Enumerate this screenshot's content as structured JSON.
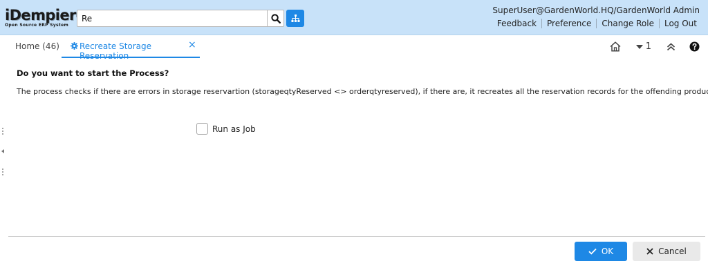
{
  "header": {
    "logo_text": "iDempiere",
    "logo_subtext": "Open Source ERP System",
    "search": {
      "value": "Re",
      "placeholder": ""
    },
    "search_icon": "search-icon",
    "menu_icon": "sitemap-icon",
    "user": "SuperUser@GardenWorld.HQ/GardenWorld Admin",
    "links": [
      "Feedback",
      "Preference",
      "Change Role",
      "Log Out"
    ]
  },
  "tabs": {
    "home": "Home (46)",
    "active": {
      "label": "Recreate Storage Reservation",
      "icon": "gear-icon",
      "close": "×"
    }
  },
  "toolbar": {
    "home_icon": "home-icon",
    "window_count": "1",
    "collapse_icon": "double-chevron-up-icon",
    "help_icon": "help-icon"
  },
  "process": {
    "question": "Do you want to start the Process?",
    "description": "The process checks if there are errors in storage reservartion (storageqtyReserved <> orderqtyreserved), if there are, it recreates all the reservation records for the offending products.",
    "run_as_job_label": "Run as Job",
    "run_as_job_checked": false
  },
  "buttons": {
    "ok": "OK",
    "cancel": "Cancel"
  },
  "colors": {
    "header_bg": "#c8e2f9",
    "accent": "#1e88e5",
    "cancel_bg": "#e9e9e9"
  }
}
